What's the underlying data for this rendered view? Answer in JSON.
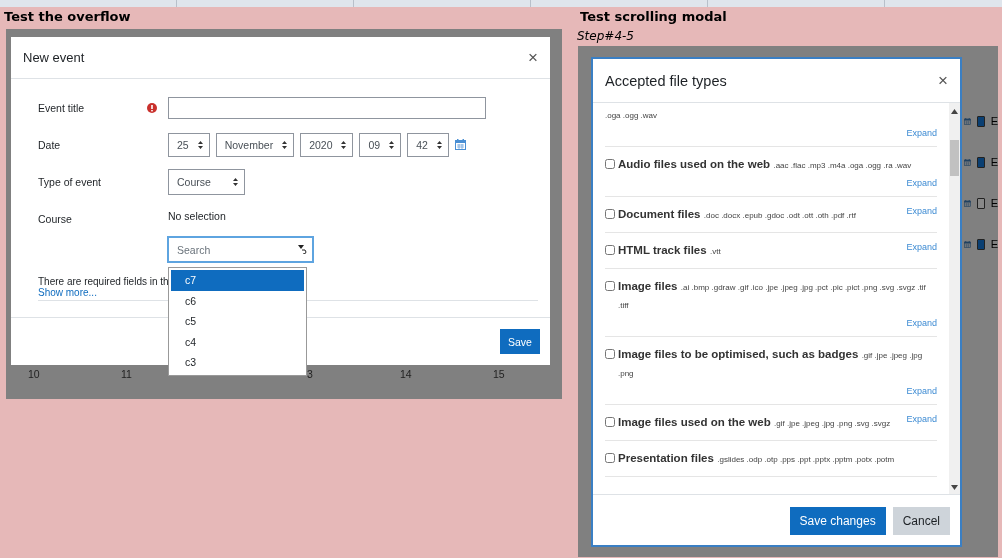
{
  "left": {
    "heading": "Test the overflow",
    "modal": {
      "title": "New event",
      "close": "×",
      "fields": [
        {
          "kind": "text",
          "label": "Event title",
          "required": true
        },
        {
          "kind": "date",
          "label": "Date",
          "selects": [
            "25",
            "November",
            "2020",
            "09",
            "42"
          ]
        },
        {
          "kind": "select",
          "label": "Type of event",
          "value": "Course"
        },
        {
          "kind": "autocomplete",
          "label": "Course",
          "value": "No selection",
          "placeholder": "Search",
          "options": [
            {
              "label": "c7",
              "selected": true
            },
            {
              "label": "c6",
              "selected": false
            },
            {
              "label": "c5",
              "selected": false
            },
            {
              "label": "c4",
              "selected": false
            },
            {
              "label": "c3",
              "selected": false
            }
          ]
        }
      ],
      "note": "There are required fields in th",
      "more_link": "Show more...",
      "save": "Save"
    },
    "calendar_days": [
      "10",
      "11",
      "3",
      "14",
      "15"
    ]
  },
  "right": {
    "heading": "Test scrolling modal",
    "subheading": "Step#4-5",
    "modal": {
      "title": "Accepted file types",
      "close": "×",
      "items": [
        {
          "extensions": ".oga .ogg .wav",
          "expand": "Expand"
        },
        {
          "name": "Audio files used on the web",
          "extensions": ".aac .flac .mp3 .m4a .oga .ogg .ra .wav",
          "checked": false,
          "expand": "Expand"
        },
        {
          "name": "Document files",
          "extensions": ".doc .docx .epub .gdoc .odt .ott .oth .pdf .rtf",
          "checked": false,
          "expand": "Expand"
        },
        {
          "name": "HTML track files",
          "extensions": ".vtt",
          "checked": false,
          "expand": "Expand"
        },
        {
          "name": "Image files",
          "extensions": ".ai .bmp .gdraw .gif .ico .jpe .jpeg .jpg .pct .pic .pict .png .svg .svgz .tif .tiff",
          "checked": false,
          "expand": "Expand"
        },
        {
          "name": "Image files to be optimised, such as badges",
          "extensions": ".gif .jpe .jpeg .jpg .png",
          "checked": false,
          "expand": "Expand"
        },
        {
          "name": "Image files used on the web",
          "extensions": ".gif .jpe .jpeg .jpg .png .svg .svgz",
          "checked": false,
          "expand": "Expand"
        },
        {
          "name": "Presentation files",
          "extensions": ".gslides .odp .otp .pps .ppt .pptx .pptm .potx .potm",
          "checked": false
        }
      ],
      "save": "Save changes",
      "cancel": "Cancel"
    },
    "behind_checkboxes": [
      {
        "checked": true,
        "label": "E"
      },
      {
        "checked": true,
        "label": "E"
      },
      {
        "checked": false,
        "label": "E"
      },
      {
        "checked": true,
        "label": "E"
      }
    ]
  }
}
